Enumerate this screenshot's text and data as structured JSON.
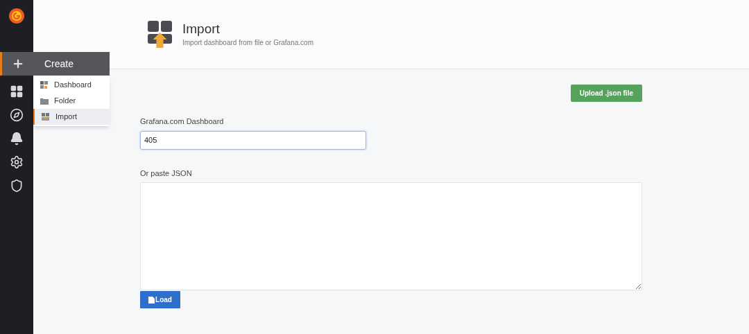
{
  "create_menu": {
    "title": "Create",
    "items": [
      {
        "label": "Dashboard",
        "kind": "dashboard",
        "selected": false
      },
      {
        "label": "Folder",
        "kind": "folder",
        "selected": false
      },
      {
        "label": "Import",
        "kind": "import",
        "selected": true
      }
    ]
  },
  "page_header": {
    "title": "Import",
    "subtitle": "Import dashboard from file or Grafana.com"
  },
  "upload_button": "Upload .json file",
  "grafana_field": {
    "label": "Grafana.com Dashboard",
    "value": "405"
  },
  "json_field": {
    "label": "Or paste JSON"
  },
  "load_button": "Load"
}
